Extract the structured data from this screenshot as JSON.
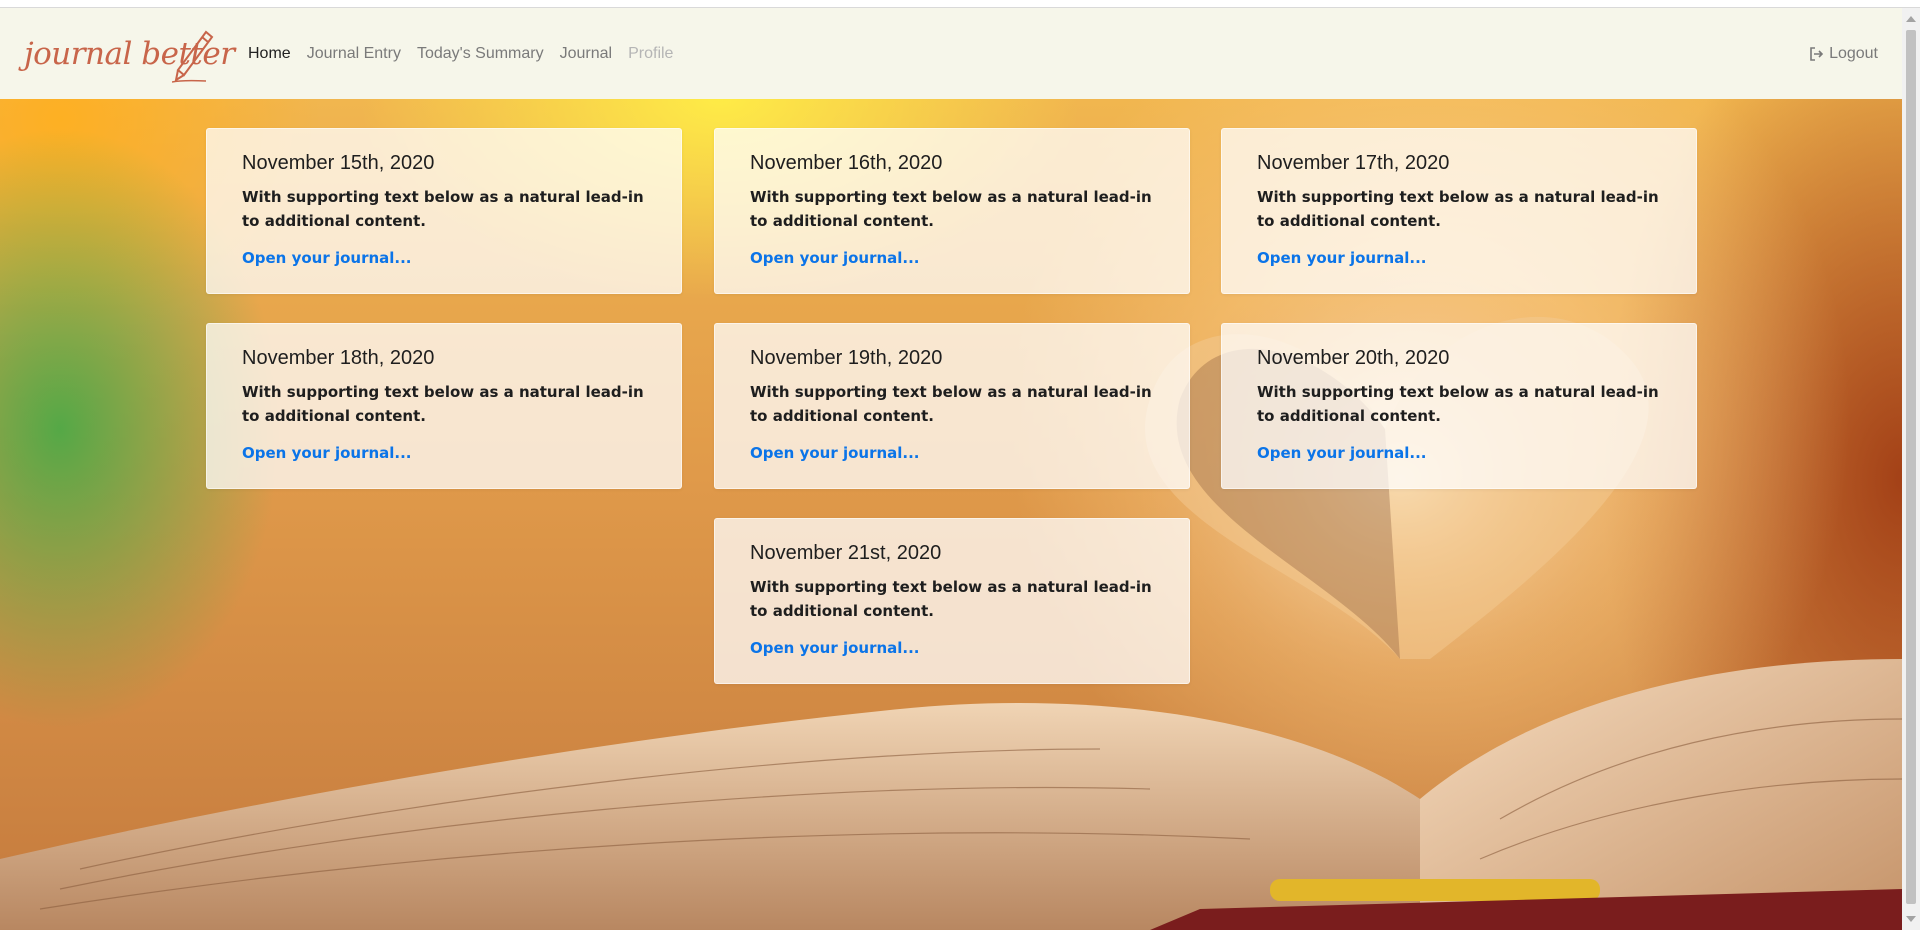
{
  "brand": {
    "name": "journal better",
    "icon": "pencil-icon"
  },
  "nav": {
    "items": [
      {
        "label": "Home",
        "state": "active"
      },
      {
        "label": "Journal Entry",
        "state": "normal"
      },
      {
        "label": "Today's Summary",
        "state": "normal"
      },
      {
        "label": "Journal",
        "state": "normal"
      },
      {
        "label": "Profile",
        "state": "disabled"
      }
    ],
    "logout": {
      "label": "Logout",
      "icon": "logout-icon"
    }
  },
  "cards": [
    {
      "title": "November 15th, 2020",
      "text": "With supporting text below as a natural lead-in to additional content.",
      "link": "Open your journal..."
    },
    {
      "title": "November 16th, 2020",
      "text": "With supporting text below as a natural lead-in to additional content.",
      "link": "Open your journal..."
    },
    {
      "title": "November 17th, 2020",
      "text": "With supporting text below as a natural lead-in to additional content.",
      "link": "Open your journal..."
    },
    {
      "title": "November 18th, 2020",
      "text": "With supporting text below as a natural lead-in to additional content.",
      "link": "Open your journal..."
    },
    {
      "title": "November 19th, 2020",
      "text": "With supporting text below as a natural lead-in to additional content.",
      "link": "Open your journal..."
    },
    {
      "title": "November 20th, 2020",
      "text": "With supporting text below as a natural lead-in to additional content.",
      "link": "Open your journal..."
    },
    {
      "title": "November 21st, 2020",
      "text": "With supporting text below as a natural lead-in to additional content.",
      "link": "Open your journal..."
    }
  ],
  "colors": {
    "navbar_bg": "#f6f6ea",
    "brand": "#c8654a",
    "link": "#0b74e8"
  }
}
